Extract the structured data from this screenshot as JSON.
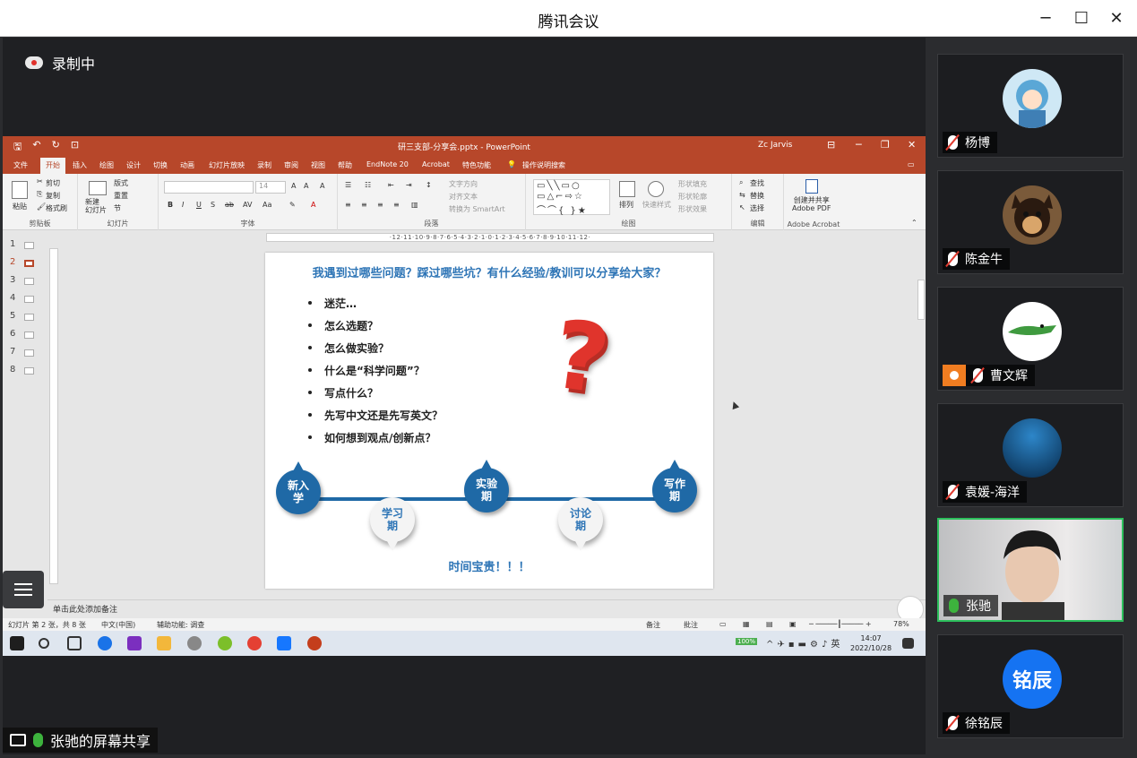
{
  "app": {
    "title": "腾讯会议"
  },
  "recording": {
    "label": "录制中"
  },
  "share_label": "张驰的屏幕共享",
  "ppt": {
    "filename": "研三支部-分享会.pptx - PowerPoint",
    "user": "Zc Jarvis",
    "menu": [
      "文件",
      "开始",
      "插入",
      "绘图",
      "设计",
      "切换",
      "动画",
      "幻灯片放映",
      "录制",
      "审阅",
      "视图",
      "帮助",
      "EndNote 20",
      "Acrobat",
      "特色功能",
      "操作说明搜索"
    ],
    "active_menu": "开始",
    "ribbon": {
      "paste": "粘贴",
      "cut": "剪切",
      "copy": "复制",
      "format_painter": "格式刷",
      "new_slide": "新建\n幻灯片",
      "layout": "版式",
      "reset": "重置",
      "section": "节",
      "font_size": "14",
      "text_direction": "文字方向",
      "align_text": "对齐文本",
      "smartart": "转换为 SmartArt",
      "arrange": "排列",
      "quick_styles": "快速样式",
      "shape_fill": "形状填充",
      "shape_outline": "形状轮廓",
      "shape_effects": "形状效果",
      "find": "查找",
      "replace": "替换",
      "select": "选择",
      "create_pdf": "创建并共享\nAdobe PDF",
      "groups": [
        "剪贴板",
        "幻灯片",
        "字体",
        "段落",
        "绘图",
        "编辑",
        "Adobe Acrobat"
      ]
    },
    "thumb_numbers": [
      "1",
      "2",
      "3",
      "4",
      "5",
      "6",
      "7",
      "8"
    ],
    "ruler": "·12·11·10·9·8·7·6·5·4·3·2·1·0·1·2·3·4·5·6·7·8·9·10·11·12·",
    "notes_placeholder": "单击此处添加备注",
    "status": {
      "slide": "幻灯片 第 2 张，共 8 张",
      "lang": "中文(中国)",
      "access": "辅助功能: 调查",
      "notes": "备注",
      "comments": "批注",
      "zoom": "78%"
    },
    "slide": {
      "title": "我遇到过哪些问题？踩过哪些坑？有什么经验/教训可以分享给大家？",
      "bullets": [
        "迷茫…",
        "怎么选题？",
        "怎么做实验？",
        "什么是“科学问题”？",
        "写点什么？",
        "先写中文还是先写英文？",
        "如何想到观点/创新点？"
      ],
      "stages_blue": [
        "新入\n学",
        "实验\n期",
        "写作\n期"
      ],
      "stages_white": [
        "学习\n期",
        "讨论\n期"
      ],
      "footer": "时间宝贵！！！"
    }
  },
  "taskbar": {
    "time": "14:07",
    "date": "2022/10/28",
    "battery": "100%"
  },
  "participants": [
    {
      "name": "杨博",
      "mic": "muted",
      "host": false
    },
    {
      "name": "陈金牛",
      "mic": "muted",
      "host": false
    },
    {
      "name": "曹文辉",
      "mic": "muted",
      "host": true
    },
    {
      "name": "袁媛-海洋",
      "mic": "muted",
      "host": false
    },
    {
      "name": "张驰",
      "mic": "on",
      "host": false,
      "active": true
    },
    {
      "name": "徐铭辰",
      "mic": "muted",
      "host": false,
      "avatar_text": "铭辰"
    }
  ],
  "colors": {
    "ppt_accent": "#b7472a",
    "slide_blue": "#2e75b6",
    "speaking": "#2dbf5c",
    "avatar_blue": "#1573f2"
  }
}
